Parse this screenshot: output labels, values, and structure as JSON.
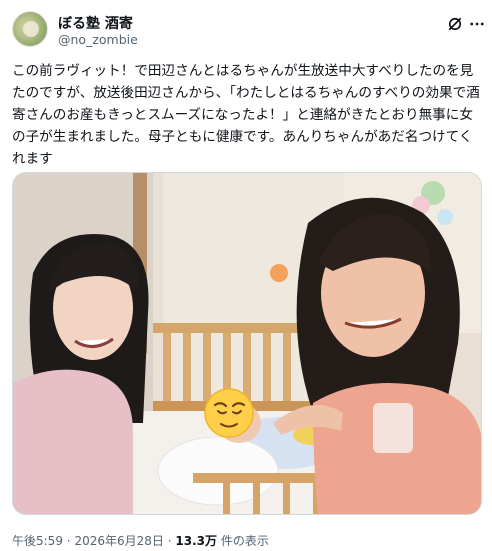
{
  "post": {
    "display_name": "ぼる塾 酒寄",
    "handle": "@no_zombie",
    "text": "この前ラヴィット！で田辺さんとはるちゃんが生放送中大すべりしたのを見たのですが、放送後田辺さんから、「わたしとはるちゃんのすべりの効果で酒寄さんのお産もきっとスムーズになったよ！」と連絡がきたとおり無事に女の子が生まれました。母子ともに健康です。あんりちゃんがあだ名つけてくれます",
    "time": "午後5:59",
    "separator": "·",
    "date": "2026年6月28日",
    "views_count": "13.3万",
    "views_label": "件の表示"
  },
  "icons": {
    "avatar": "avatar",
    "grok": "grok-icon",
    "more": "more-icon",
    "emoji_sticker": "relieved-face-emoji"
  },
  "colors": {
    "text": "#0f1419",
    "secondary": "#536471",
    "border": "#cfd9de"
  }
}
